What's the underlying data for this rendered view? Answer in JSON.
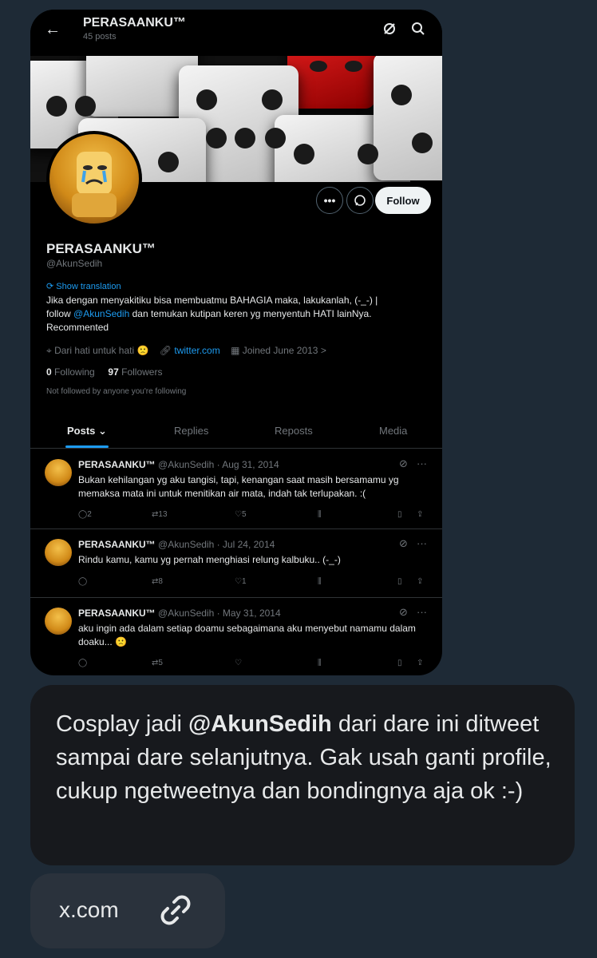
{
  "profile": {
    "header_title": "PERASAANKU™",
    "post_count": "45 posts",
    "display_name": "PERASAANKU™",
    "handle": "@AkunSedih",
    "show_translation": "Show translation",
    "bio_part1": "Jika dengan menyakitiku bisa membuatmu BAHAGIA maka, lakukanlah, (‑_‑) |",
    "bio_follow_word": "follow",
    "bio_mention": "@AkunSedih",
    "bio_part2": "dan temukan kutipan keren yg menyentuh HATI lainNya.",
    "bio_part3": "Recommented",
    "location": "Dari hati untuk hati 🙁",
    "website": "twitter.com",
    "joined": "Joined June 2013 >",
    "following_count": "0",
    "following_label": "Following",
    "followers_count": "97",
    "followers_label": "Followers",
    "not_followed": "Not followed by anyone you're following",
    "follow_button": "Follow",
    "more_button": "•••"
  },
  "tabs": [
    {
      "label": "Posts ⌄"
    },
    {
      "label": "Replies"
    },
    {
      "label": "Reposts"
    },
    {
      "label": "Media"
    }
  ],
  "posts": [
    {
      "name": "PERASAANKU™",
      "meta": "@AkunSedih · Aug 31, 2014",
      "text": "Bukan kehilangan yg aku tangisi, tapi, kenangan saat masih bersamamu yg memaksa mata ini untuk menitikan air mata, indah tak terlupakan. :(",
      "replies": "2",
      "reposts": "13",
      "likes": "5"
    },
    {
      "name": "PERASAANKU™",
      "meta": "@AkunSedih · Jul 24, 2014",
      "text": "Rindu kamu, kamu yg pernah menghiasi relung kalbuku.. (‑_‑)",
      "replies": "",
      "reposts": "8",
      "likes": "1"
    },
    {
      "name": "PERASAANKU™",
      "meta": "@AkunSedih · May 31, 2014",
      "text": "aku ingin ada dalam setiap doamu sebagaimana aku menyebut namamu dalam doaku... 🙁",
      "replies": "",
      "reposts": "5",
      "likes": ""
    }
  ],
  "message": {
    "part1": "Cosplay jadi ",
    "mention": "@AkunSedih",
    "part2": " dari dare ini ditweet sampai dare selanjutnya. Gak usah ganti profile, cukup ngetweetnya dan bondingnya aja ok :-)"
  },
  "link_chip": {
    "label": "x.com"
  },
  "colors": {
    "accent": "#1d9bf0",
    "page_bg": "#1e2a36",
    "bubble_bg": "#17191d"
  },
  "icons": [
    "back-arrow-icon",
    "grok-icon",
    "search-icon",
    "location-icon",
    "link-icon",
    "calendar-icon",
    "message-icon",
    "reply-icon",
    "repost-icon",
    "like-icon",
    "views-icon",
    "bookmark-icon",
    "share-icon"
  ]
}
